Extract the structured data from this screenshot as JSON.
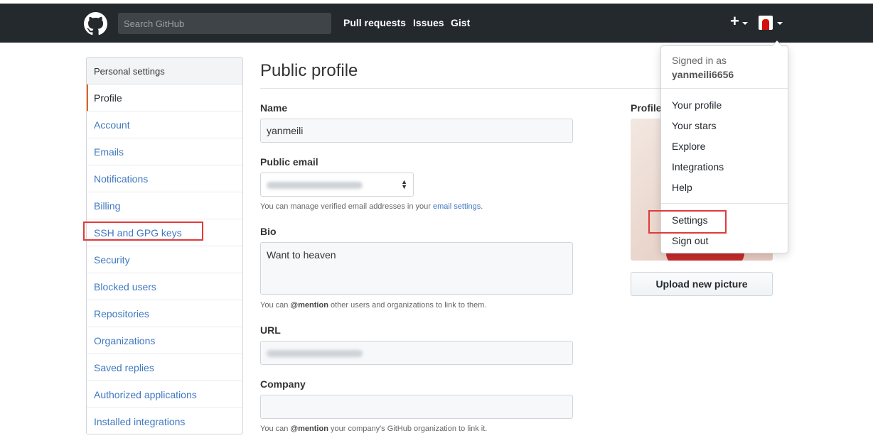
{
  "header": {
    "search_placeholder": "Search GitHub",
    "nav": [
      "Pull requests",
      "Issues",
      "Gist"
    ],
    "plus_label": "+"
  },
  "sidebar": {
    "heading": "Personal settings",
    "items": [
      {
        "label": "Profile"
      },
      {
        "label": "Account"
      },
      {
        "label": "Emails"
      },
      {
        "label": "Notifications"
      },
      {
        "label": "Billing"
      },
      {
        "label": "SSH and GPG keys"
      },
      {
        "label": "Security"
      },
      {
        "label": "Blocked users"
      },
      {
        "label": "Repositories"
      },
      {
        "label": "Organizations"
      },
      {
        "label": "Saved replies"
      },
      {
        "label": "Authorized applications"
      },
      {
        "label": "Installed integrations"
      }
    ]
  },
  "main": {
    "title": "Public profile",
    "name_label": "Name",
    "name_value": "yanmeili",
    "email_label": "Public email",
    "email_note_prefix": "You can manage verified email addresses in your ",
    "email_note_link": "email settings",
    "email_note_suffix": ".",
    "bio_label": "Bio",
    "bio_value": "Want to heaven",
    "bio_note_prefix": "You can ",
    "bio_note_mention": "@mention",
    "bio_note_suffix": " other users and organizations to link to them.",
    "url_label": "URL",
    "company_label": "Company",
    "company_note_prefix": "You can ",
    "company_note_mention": "@mention",
    "company_note_suffix": " your company's GitHub organization to link it.",
    "profile_label": "Profile",
    "upload_button": "Upload new picture"
  },
  "dropdown": {
    "signed_in_as": "Signed in as",
    "username": "yanmeili6656",
    "items": [
      "Your profile",
      "Your stars",
      "Explore",
      "Integrations",
      "Help"
    ],
    "items2": [
      "Settings",
      "Sign out"
    ]
  },
  "colors": {
    "header_bg": "#24292e",
    "link": "#4078c0",
    "active_marker": "#e36209",
    "highlight": "#e03a3a"
  }
}
